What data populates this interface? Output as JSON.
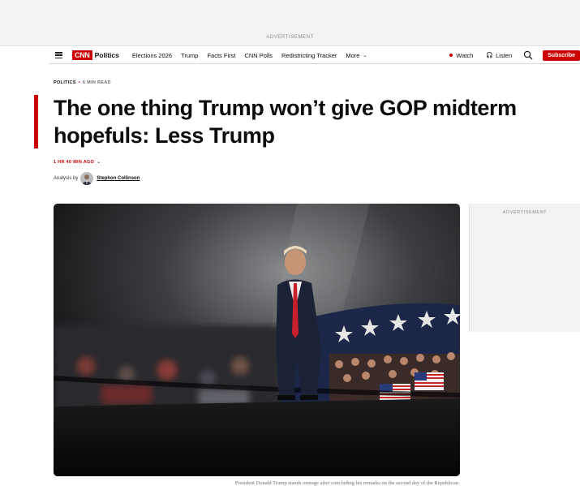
{
  "ads": {
    "top_label": "ADVERTISEMENT",
    "side_label": "ADVERTISEMENT"
  },
  "nav": {
    "menu_icon": "hamburger-menu-icon",
    "logo": "CNN",
    "section": "Politics",
    "links": [
      "Elections 2026",
      "Trump",
      "Facts First",
      "CNN Polls",
      "Redistricting Tracker"
    ],
    "more": "More",
    "watch": "Watch",
    "listen": "Listen",
    "search_icon": "search-icon",
    "subscribe": "Subscribe"
  },
  "article": {
    "section": "POLITICS",
    "read_time": "6 MIN READ",
    "headline": "The one thing Trump won’t give GOP midterm hopefuls: Less Trump",
    "timestamp": "1 HR 40 MIN AGO",
    "byline_prefix": "Analysis by",
    "author": "Stephon Collinson",
    "image_caption": "President Donald Trump stands onstage after concluding his remarks on the second day of the Republican"
  },
  "colors": {
    "brand_red": "#cc0000",
    "ad_background": "#f2f2f2"
  }
}
